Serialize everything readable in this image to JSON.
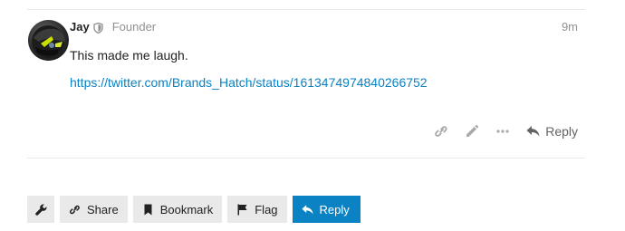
{
  "post": {
    "username": "Jay",
    "user_title": "Founder",
    "age": "9m",
    "text": "This made me laugh.",
    "link": "https://twitter.com/Brands_Hatch/status/1613474974840266752",
    "reply_label": "Reply"
  },
  "footer": {
    "share_label": "Share",
    "bookmark_label": "Bookmark",
    "flag_label": "Flag",
    "reply_label": "Reply"
  },
  "icons": {
    "moderator": "shield-icon",
    "copy_link": "link-icon",
    "edit": "pencil-icon",
    "more": "ellipsis-icon",
    "reply": "reply-arrow-icon",
    "admin": "wrench-icon",
    "bookmark": "bookmark-icon",
    "flag": "flag-icon"
  },
  "colors": {
    "link": "#0a82c4",
    "primary_button": "#0a82c4",
    "muted_text": "#919191",
    "button_bg": "#e9e9e9"
  }
}
